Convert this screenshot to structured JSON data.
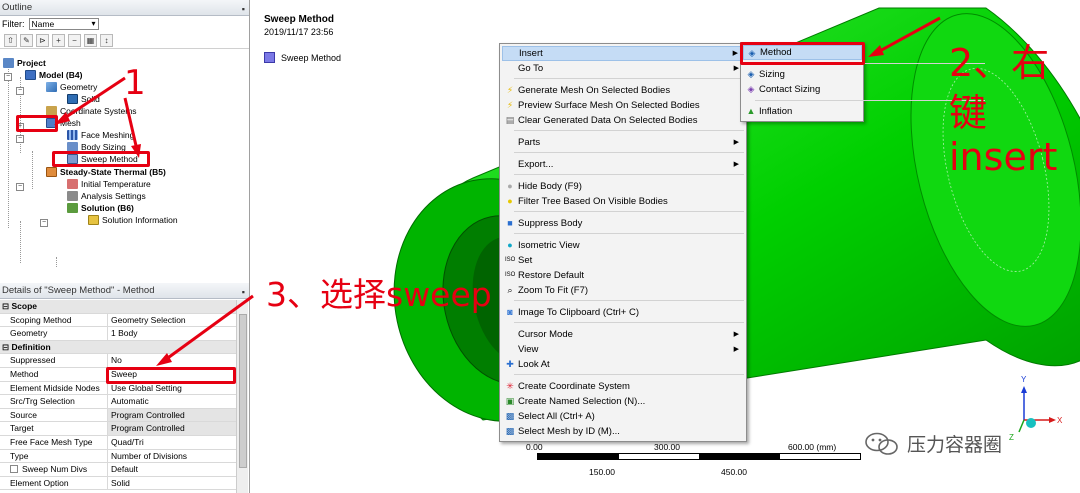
{
  "outline": {
    "title": "Outline",
    "filter_label": "Filter:",
    "filter_value": "Name",
    "tree": [
      {
        "label": "Project",
        "bold": true
      },
      {
        "label": "Model (B4)",
        "bold": true
      },
      {
        "label": "Geometry"
      },
      {
        "label": "Solid"
      },
      {
        "label": "Coordinate Systems"
      },
      {
        "label": "Mesh"
      },
      {
        "label": "Face Meshing"
      },
      {
        "label": "Body Sizing"
      },
      {
        "label": "Sweep Method"
      },
      {
        "label": "Steady-State Thermal (B5)",
        "bold": true
      },
      {
        "label": "Initial Temperature"
      },
      {
        "label": "Analysis Settings"
      },
      {
        "label": "Solution (B6)",
        "bold": true
      },
      {
        "label": "Solution Information"
      }
    ]
  },
  "details": {
    "title": "Details of \"Sweep Method\" - Method",
    "rows": [
      {
        "section": "Scope"
      },
      {
        "key": "Scoping Method",
        "value": "Geometry Selection"
      },
      {
        "key": "Geometry",
        "value": "1 Body"
      },
      {
        "section": "Definition"
      },
      {
        "key": "Suppressed",
        "value": "No"
      },
      {
        "key": "Method",
        "value": "Sweep"
      },
      {
        "key": "Element Midside Nodes",
        "value": "Use Global Setting"
      },
      {
        "key": "Src/Trg Selection",
        "value": "Automatic"
      },
      {
        "key": "Source",
        "value": "Program Controlled",
        "gray": true
      },
      {
        "key": "Target",
        "value": "Program Controlled",
        "gray": true
      },
      {
        "key": "Free Face Mesh Type",
        "value": "Quad/Tri"
      },
      {
        "key": "Type",
        "value": "Number of Divisions"
      },
      {
        "key": "Sweep Num Divs",
        "value": "Default",
        "checkbox": true
      },
      {
        "key": "Element Option",
        "value": "Solid"
      }
    ]
  },
  "viewport": {
    "title": "Sweep Method",
    "date": "2019/11/17 23:56",
    "legend": "Sweep Method",
    "legend_color": "#7b79e6",
    "model_color": "#00d000"
  },
  "context_menu": {
    "items": [
      {
        "label": "Insert",
        "submenu": true,
        "highlight": true
      },
      {
        "label": "Go To",
        "submenu": true
      },
      {
        "label": "Generate Mesh On Selected Bodies",
        "icon": "lightning-icon"
      },
      {
        "label": "Preview Surface Mesh On Selected Bodies",
        "icon": "lightning-icon"
      },
      {
        "label": "Clear Generated Data On Selected Bodies",
        "icon": "clear-icon"
      },
      {
        "label": "Parts",
        "submenu": true
      },
      {
        "label": "Export...",
        "submenu": true
      },
      {
        "label": "Hide Body (F9)",
        "icon": "bulb-icon"
      },
      {
        "label": "Filter Tree Based On Visible Bodies",
        "icon": "bulb-icon"
      },
      {
        "label": "Suppress Body",
        "icon": "suppress-icon"
      },
      {
        "label": "Isometric View",
        "icon": "sphere-icon"
      },
      {
        "label": "Set",
        "icon": "iso-icon"
      },
      {
        "label": "Restore Default",
        "icon": "iso-icon"
      },
      {
        "label": "Zoom To Fit (F7)",
        "icon": "zoom-icon"
      },
      {
        "label": "Image To Clipboard (Ctrl+ C)",
        "icon": "camera-icon"
      },
      {
        "label": "Cursor Mode",
        "submenu": true
      },
      {
        "label": "View",
        "submenu": true
      },
      {
        "label": "Look At",
        "icon": "look-icon"
      },
      {
        "label": "Create Coordinate System",
        "icon": "coord-icon"
      },
      {
        "label": "Create Named Selection (N)...",
        "icon": "named-icon"
      },
      {
        "label": "Select All (Ctrl+ A)",
        "icon": "select-icon"
      },
      {
        "label": "Select Mesh by ID (M)...",
        "icon": "select-icon"
      }
    ]
  },
  "submenu": {
    "items": [
      {
        "label": "Method",
        "highlight": true
      },
      {
        "label": "Sizing"
      },
      {
        "label": "Contact Sizing"
      },
      {
        "label": "Inflation"
      }
    ]
  },
  "annotations": {
    "step1": "1",
    "step2_a": "2、右",
    "step2_b": "键",
    "step2_c": "insert",
    "step3": "3、选择sweep",
    "color": "#e60012"
  },
  "scale": {
    "top_labels": [
      "0.00",
      "300.00",
      "600.00 (mm)"
    ],
    "bottom_labels": [
      "150.00",
      "450.00"
    ]
  },
  "watermark": "压力容器圈"
}
